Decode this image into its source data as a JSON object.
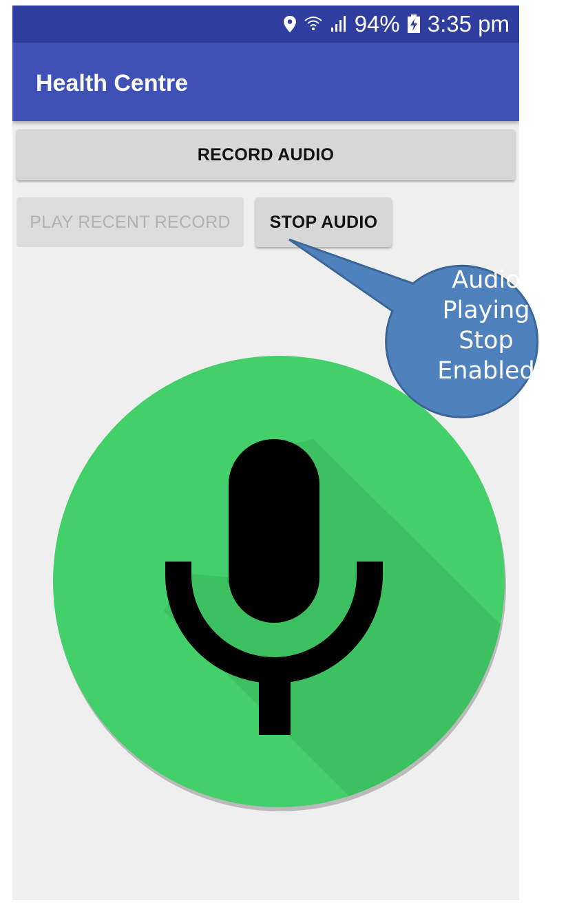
{
  "status_bar": {
    "battery": "94%",
    "time": "3:35 pm",
    "icons": [
      "location-icon",
      "wifi-icon",
      "signal-icon",
      "battery-charging-icon"
    ]
  },
  "app_bar": {
    "title": "Health Centre"
  },
  "buttons": {
    "record": "RECORD AUDIO",
    "play_recent": "PLAY RECENT RECORD",
    "stop": "STOP AUDIO"
  },
  "callout": {
    "lines": [
      "Audio",
      "Playing",
      "Stop",
      "Enabled"
    ]
  },
  "colors": {
    "status_bar": "#2f3e9e",
    "app_bar": "#3f51b5",
    "fab_green": "#43cf69",
    "callout_fill": "#4f81bd"
  },
  "mic": {
    "icon": "microphone-icon"
  }
}
